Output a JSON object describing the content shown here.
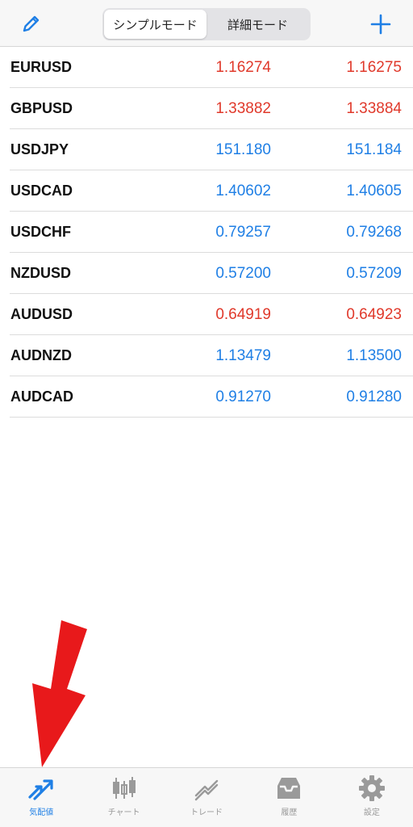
{
  "header": {
    "edit_icon": "pencil-icon",
    "add_icon": "plus-icon",
    "segments": [
      {
        "label": "シンプルモード",
        "active": true
      },
      {
        "label": "詳細モード",
        "active": false
      }
    ]
  },
  "colors": {
    "accent": "#1f7fe5",
    "down": "#e0392b",
    "up": "#1f7fe5",
    "annotation_arrow": "#e8191b"
  },
  "quotes": [
    {
      "symbol": "EURUSD",
      "bid": "1.16274",
      "ask": "1.16275",
      "color": "red"
    },
    {
      "symbol": "GBPUSD",
      "bid": "1.33882",
      "ask": "1.33884",
      "color": "red"
    },
    {
      "symbol": "USDJPY",
      "bid": "151.180",
      "ask": "151.184",
      "color": "blue"
    },
    {
      "symbol": "USDCAD",
      "bid": "1.40602",
      "ask": "1.40605",
      "color": "blue"
    },
    {
      "symbol": "USDCHF",
      "bid": "0.79257",
      "ask": "0.79268",
      "color": "blue"
    },
    {
      "symbol": "NZDUSD",
      "bid": "0.57200",
      "ask": "0.57209",
      "color": "blue"
    },
    {
      "symbol": "AUDUSD",
      "bid": "0.64919",
      "ask": "0.64923",
      "color": "red"
    },
    {
      "symbol": "AUDNZD",
      "bid": "1.13479",
      "ask": "1.13500",
      "color": "blue"
    },
    {
      "symbol": "AUDCAD",
      "bid": "0.91270",
      "ask": "0.91280",
      "color": "blue"
    }
  ],
  "tabs": [
    {
      "label": "気配値",
      "icon": "quotes-arrows-icon",
      "active": true
    },
    {
      "label": "チャート",
      "icon": "candlestick-chart-icon",
      "active": false
    },
    {
      "label": "トレード",
      "icon": "trade-line-icon",
      "active": false
    },
    {
      "label": "履歴",
      "icon": "inbox-tray-icon",
      "active": false
    },
    {
      "label": "設定",
      "icon": "gear-icon",
      "active": false
    }
  ]
}
